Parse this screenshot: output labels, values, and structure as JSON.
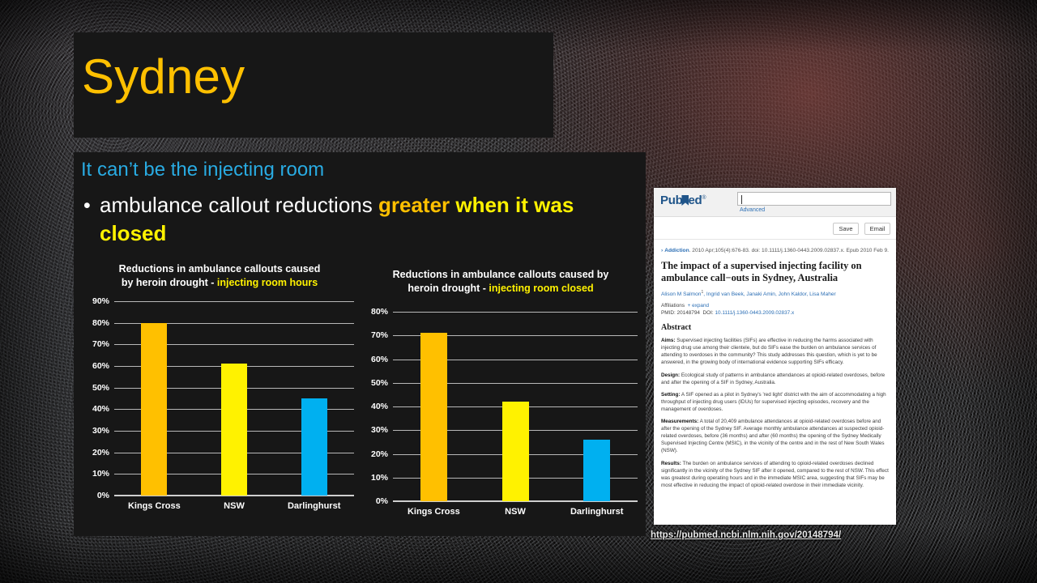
{
  "slide": {
    "title": "Sydney",
    "subtitle": "It can’t be the injecting room",
    "bullet_marker": "•",
    "bullet": {
      "plain_start": "ambulance callout reductions ",
      "amber": "greater",
      "yellow": " when it was closed"
    }
  },
  "chart_data": [
    {
      "type": "bar",
      "id": "chart-1",
      "title_line1": "Reductions in ambulance callouts caused",
      "title_line2_plain": "by heroin drought - ",
      "title_line2_accent": "injecting room hours",
      "categories": [
        "Kings Cross",
        "NSW",
        "Darlinghurst"
      ],
      "values": [
        80,
        61,
        45
      ],
      "colors": [
        "#FFC000",
        "#FFF200",
        "#00B0F0"
      ],
      "ylim": [
        0,
        90
      ],
      "yticks": [
        90,
        80,
        70,
        60,
        50,
        40,
        30,
        20,
        10,
        0
      ],
      "ytick_labels": [
        "90%",
        "80%",
        "70%",
        "60%",
        "50%",
        "40%",
        "30%",
        "20%",
        "10%",
        "0%"
      ],
      "xlabel": "",
      "ylabel": "",
      "grid": true,
      "legend": "none"
    },
    {
      "type": "bar",
      "id": "chart-2",
      "title_line1": "Reductions in ambulance callouts caused by",
      "title_line2_plain": "heroin drought - ",
      "title_line2_accent": "injecting room closed",
      "categories": [
        "Kings Cross",
        "NSW",
        "Darlinghurst"
      ],
      "values": [
        71,
        42,
        26
      ],
      "colors": [
        "#FFC000",
        "#FFF200",
        "#00B0F0"
      ],
      "ylim": [
        0,
        80
      ],
      "yticks": [
        80,
        70,
        60,
        50,
        40,
        30,
        20,
        10,
        0
      ],
      "ytick_labels": [
        "80%",
        "70%",
        "60%",
        "50%",
        "40%",
        "30%",
        "20%",
        "10%",
        "0%"
      ],
      "xlabel": "",
      "ylabel": "",
      "grid": true,
      "legend": "none"
    }
  ],
  "pubmed": {
    "logo_pub": "Pub",
    "logo_med": "ed",
    "logo_reg": "®",
    "search_value": "",
    "search_placeholder": "",
    "advanced_link": "Advanced",
    "save_button": "Save",
    "email_button": "Email",
    "citation_journal": "Addiction",
    "citation_rest": ". 2010 Apr;105(4):676-83. doi: 10.1111/j.1360-0443.2009.02837.x. Epub 2010 Feb 9.",
    "article_title": "The impact of a supervised injecting facility on ambulance call−outs in Sydney, Australia",
    "authors": "Alison M Salmon",
    "authors_sup": "1",
    "authors_rest": ", Ingrid van Beek, Janaki Amin, John Kaldor, Lisa Maher",
    "affiliations": "Affiliations",
    "affiliations_expand": "+ expand",
    "pmid": "PMID: 20148794",
    "doi_label": "DOI:",
    "doi_value": "10.1111/j.1360-0443.2009.02837.x",
    "abstract_heading": "Abstract",
    "aims_label": "Aims:",
    "aims_text": " Supervised injecting facilities (SIFs) are effective in reducing the harms associated with injecting drug use among their clientele, but do SIFs ease the burden on ambulance services of attending to overdoses in the community? This study addresses this question, which is yet to be answered, in the growing body of international evidence supporting SIFs efficacy.",
    "design_label": "Design:",
    "design_text": " Ecological study of patterns in ambulance attendances at opioid-related overdoses, before and after the opening of a SIF in Sydney, Australia.",
    "setting_label": "Setting:",
    "setting_text": " A SIF opened as a pilot in Sydney's 'red light' district with the aim of accommodating a high throughput of injecting drug users (IDUs) for supervised injecting episodes, recovery and the management of overdoses.",
    "measurements_label": "Measurements:",
    "measurements_text": " A total of 20,409 ambulance attendances at opioid-related overdoses before and after the opening of the Sydney SIF. Average monthly ambulance attendances at suspected opioid-related overdoses, before (36 months) and after (60 months) the opening of the Sydney Medically Supervised Injecting Centre (MSIC), in the vicinity of the centre and in the rest of New South Wales (NSW).",
    "results_label": "Results:",
    "results_text": " The burden on ambulance services of attending to opioid-related overdoses declined significantly in the vicinity of the Sydney SIF after it opened, compared to the rest of NSW. This effect was greatest during operating hours and in the immediate MSIC area, suggesting that SIFs may be most effective in reducing the impact of opioid-related overdose in their immediate vicinity."
  },
  "url_caption": "https://pubmed.ncbi.nlm.nih.gov/20148794/",
  "colors": {
    "title_gold": "#FFC000",
    "subtitle_blue": "#29ABE2",
    "bright_yellow": "#FFF200",
    "bar_blue": "#00B0F0",
    "panel_black": "#171717"
  }
}
